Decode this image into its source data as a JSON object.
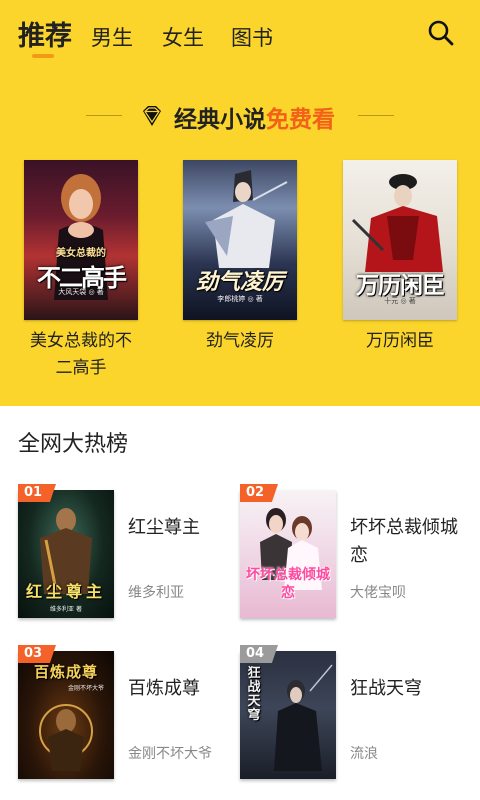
{
  "tabs": [
    {
      "label": "推荐",
      "active": true
    },
    {
      "label": "男生",
      "active": false
    },
    {
      "label": "女生",
      "active": false
    },
    {
      "label": "图书",
      "active": false
    }
  ],
  "banner": {
    "text_main": "经典小说",
    "text_highlight": "免费看",
    "icon": "diamond-icon"
  },
  "featured": [
    {
      "title": "美女总裁的不二高手",
      "cover_title_top": "美女总裁的",
      "cover_title_big": "不二高手",
      "cover_author": "大风天袋 ◎ 著"
    },
    {
      "title": "劲气凌厉",
      "cover_title_big": "劲气凌厉",
      "cover_author": "李郎桃婷 ◎ 著"
    },
    {
      "title": "万历闲臣",
      "cover_title_big": "万历闲臣",
      "cover_author": "十元 ◎ 著"
    }
  ],
  "ranking": {
    "section_title": "全网大热榜",
    "items": [
      {
        "rank": "01",
        "title": "红尘尊主",
        "author": "维多利亚",
        "cover_text": "红尘尊主",
        "cover_sub": "维多利亚 著"
      },
      {
        "rank": "02",
        "title": "坏坏总裁倾城恋",
        "author": "大佬宝呗",
        "cover_text": "坏坏总裁倾城恋"
      },
      {
        "rank": "03",
        "title": "百炼成尊",
        "author": "金刚不坏大爷",
        "cover_text": "百炼成尊",
        "cover_sub": "金刚不坏大爷"
      },
      {
        "rank": "04",
        "title": "狂战天穹",
        "author": "流浪",
        "cover_text": "狂战天穹"
      }
    ]
  },
  "colors": {
    "header_bg": "#fbd52b",
    "accent": "#f29a15",
    "highlight": "#f3601a"
  }
}
